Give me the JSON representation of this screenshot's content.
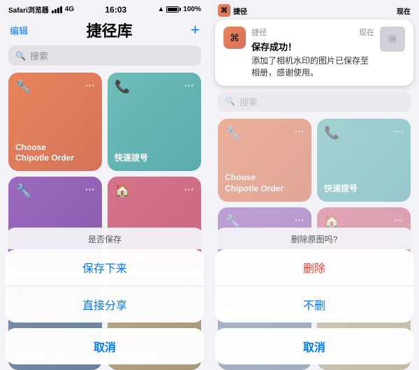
{
  "left_panel": {
    "status": {
      "carrier": "Safari浏览器",
      "signal": "4G",
      "time": "16:03",
      "battery": 100
    },
    "header": {
      "edit_label": "编辑",
      "title": "捷径库",
      "add_label": "+"
    },
    "search": {
      "placeholder": "搜索"
    },
    "cards": [
      {
        "id": "choose-chipotle",
        "color": "card-orange",
        "icon": "🔧",
        "title": "Choose\nChipotle Order"
      },
      {
        "id": "quick-dial",
        "color": "card-teal",
        "icon": "📞",
        "title": "快速拨号"
      },
      {
        "id": "untitled-workflow",
        "color": "card-purple",
        "icon": "🔧",
        "title": "Untitled Workflow"
      },
      {
        "id": "home-eta",
        "color": "card-pink",
        "icon": "🏠",
        "title": "预计到家时间"
      },
      {
        "id": "play-playlist",
        "color": "card-blue-gray",
        "icon": "≡",
        "title": "播放播放列表"
      },
      {
        "id": "unnamed-shortcut",
        "color": "card-tan",
        "icon": "🔧",
        "title": "未命名捷径"
      }
    ],
    "action_sheet": {
      "title": "是否保存",
      "buttons": [
        {
          "id": "save-btn",
          "label": "保存下来",
          "type": "normal"
        },
        {
          "id": "share-btn",
          "label": "直接分享",
          "type": "normal"
        }
      ],
      "cancel_label": "取消"
    }
  },
  "right_panel": {
    "status": {
      "app_name": "捷径",
      "now_label": "现在"
    },
    "notification": {
      "app_label": "捷径",
      "time_label": "现在",
      "title": "保存成功！",
      "body": "添加了相机水印的图片已保存至相册，感谢使用。"
    },
    "search": {
      "placeholder": "搜索"
    },
    "cards": [
      {
        "id": "choose-chipotle-r",
        "color": "card-orange",
        "icon": "🔧",
        "title": "Choose\nChipotle Order"
      },
      {
        "id": "quick-dial-r",
        "color": "card-teal",
        "icon": "📞",
        "title": "快速拨号"
      },
      {
        "id": "untitled-workflow-r",
        "color": "card-purple",
        "icon": "🔧",
        "title": "Untitled Workflow"
      },
      {
        "id": "home-eta-r",
        "color": "card-pink",
        "icon": "🏠",
        "title": "预计到家时间"
      },
      {
        "id": "play-playlist-r",
        "color": "card-blue-gray",
        "icon": "≡",
        "title": "播放播放列表"
      },
      {
        "id": "unnamed-shortcut-r",
        "color": "card-tan",
        "icon": "🔧",
        "title": "未命名捷径"
      }
    ],
    "action_sheet": {
      "title": "删除原图吗?",
      "buttons": [
        {
          "id": "delete-btn",
          "label": "删除",
          "type": "destructive"
        },
        {
          "id": "keep-btn",
          "label": "不删",
          "type": "normal"
        }
      ],
      "cancel_label": "取消"
    }
  }
}
